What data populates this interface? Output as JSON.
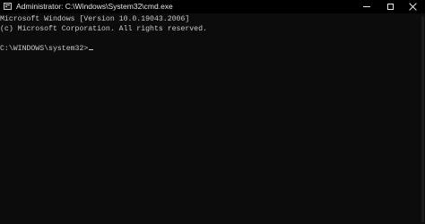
{
  "window": {
    "title": "Administrator: C:\\Windows\\System32\\cmd.exe",
    "icon": "cmd-app-icon"
  },
  "controls": {
    "minimize": "minimize-icon",
    "maximize": "maximize-icon",
    "close": "close-icon"
  },
  "console": {
    "lines": [
      "Microsoft Windows [Version 10.0.19043.2006]",
      "(c) Microsoft Corporation. All rights reserved.",
      "",
      "C:\\WINDOWS\\system32>"
    ],
    "text_color": "#cccccc",
    "background": "#0c0c0c"
  }
}
